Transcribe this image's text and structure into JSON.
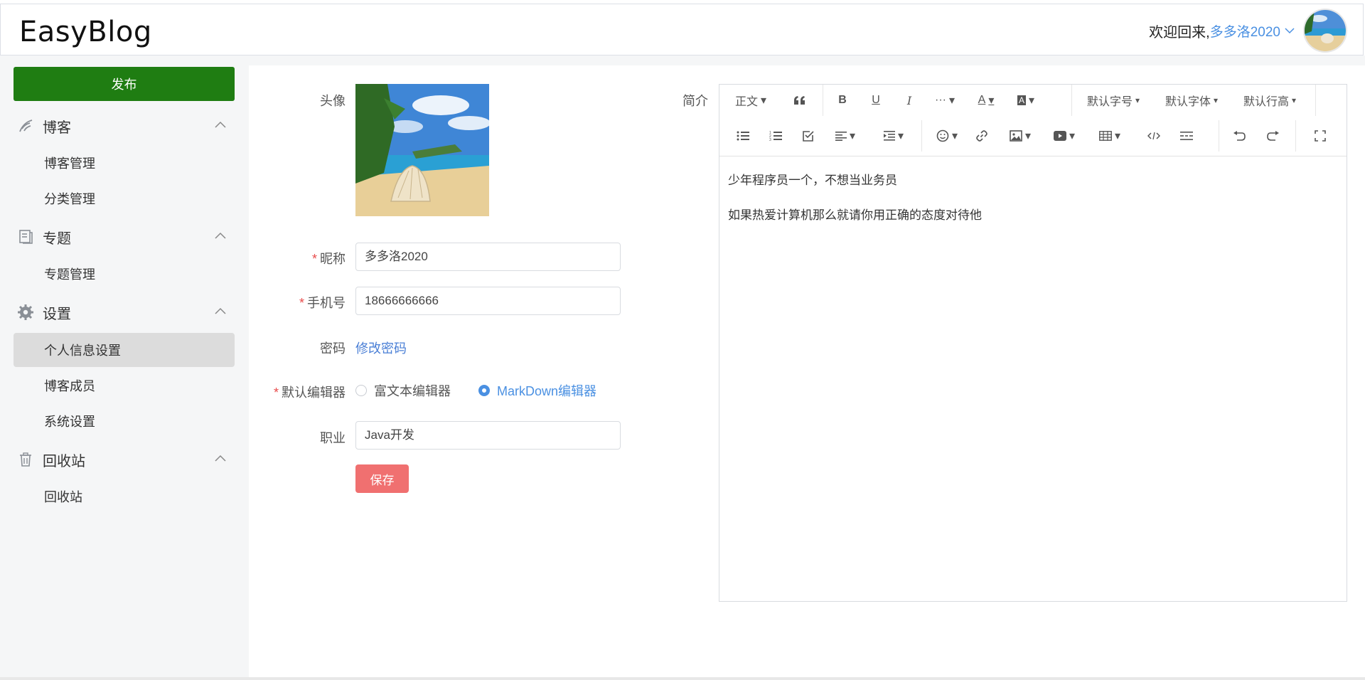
{
  "header": {
    "logo": "EasyBlog",
    "welcome": "欢迎回来,",
    "username": "多多洛2020"
  },
  "sidebar": {
    "publish_label": "发布",
    "groups": [
      {
        "title": "博客",
        "icon": "blog-icon",
        "items": [
          "博客管理",
          "分类管理"
        ]
      },
      {
        "title": "专题",
        "icon": "topic-icon",
        "items": [
          "专题管理"
        ]
      },
      {
        "title": "设置",
        "icon": "gear-icon",
        "items": [
          "个人信息设置",
          "博客成员",
          "系统设置"
        ]
      },
      {
        "title": "回收站",
        "icon": "trash-icon",
        "items": [
          "回收站"
        ]
      }
    ],
    "active_item": "个人信息设置"
  },
  "form": {
    "avatar_label": "头像",
    "nickname_label": "昵称",
    "nickname_value": "多多洛2020",
    "phone_label": "手机号",
    "phone_value": "18666666666",
    "password_label": "密码",
    "password_link": "修改密码",
    "editor_label": "默认编辑器",
    "editor_options": [
      "富文本编辑器",
      "MarkDown编辑器"
    ],
    "editor_selected": "MarkDown编辑器",
    "job_label": "职业",
    "job_value": "Java开发",
    "save_label": "保存",
    "intro_label": "简介"
  },
  "editor": {
    "toolbar_row1": {
      "paragraph": "正文",
      "font_size": "默认字号",
      "font_family": "默认字体",
      "line_height": "默认行高"
    },
    "content": [
      "少年程序员一个，不想当业务员",
      "如果热爱计算机那么就请你用正确的态度对待他"
    ]
  },
  "colors": {
    "publish_green": "#1f7d12",
    "save_red": "#f07070",
    "link_blue": "#4a90e2",
    "sidebar_bg": "#f5f6f7"
  }
}
